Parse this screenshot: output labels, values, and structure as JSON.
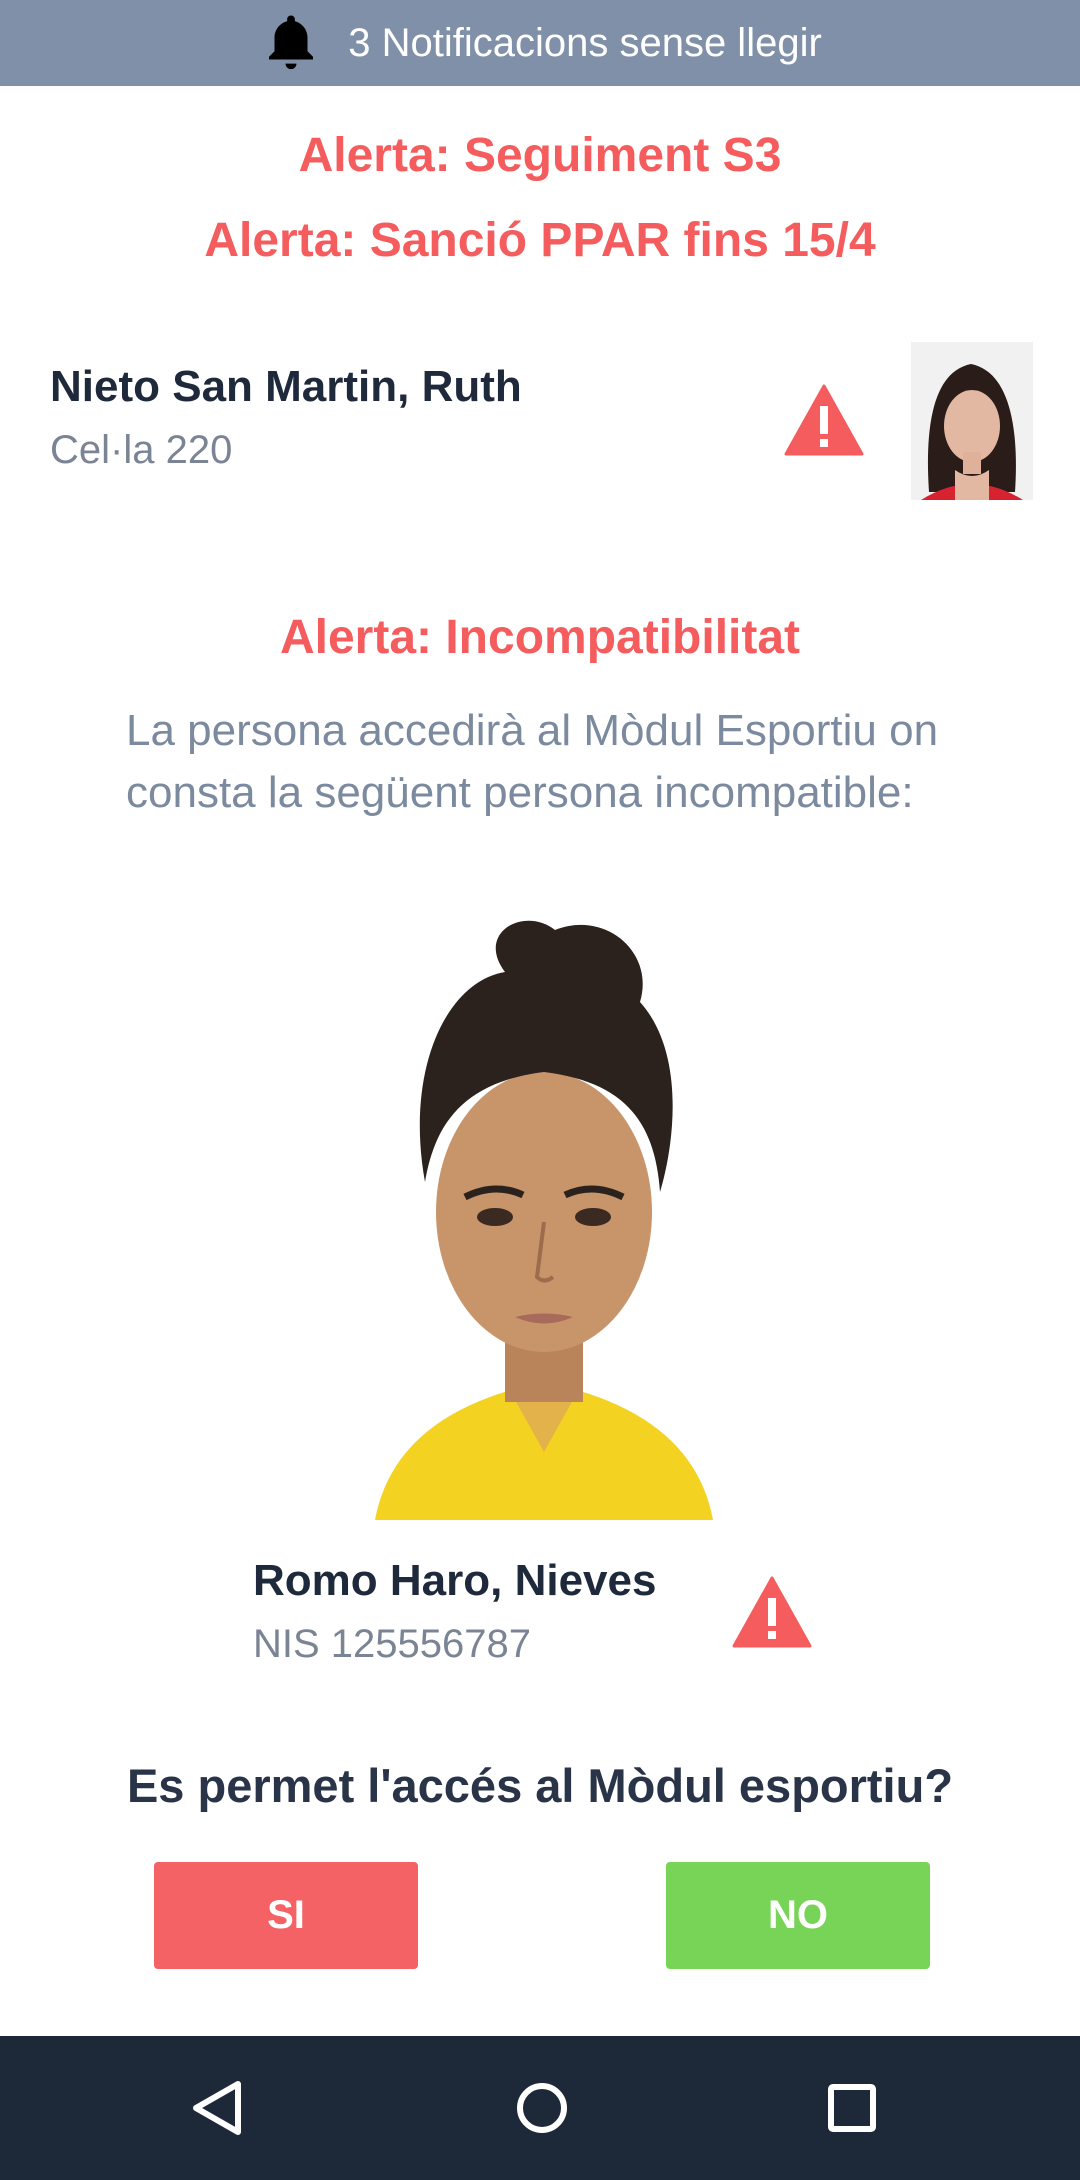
{
  "notification": {
    "icon": "bell-icon",
    "text": "3 Notificacions sense llegir"
  },
  "alerts": {
    "alert_1": "Alerta: Seguiment S3",
    "alert_2": "Alerta: Sanció PPAR fins 15/4",
    "alert_3": "Alerta: Incompatibilitat"
  },
  "person": {
    "name": "Nieto San Martin, Ruth",
    "cell": "Cel·la 220"
  },
  "incompatibility": {
    "description": "La persona accedirà al Mòdul Esportiu on consta la següent persona incompatible:",
    "name": "Romo Haro, Nieves",
    "nis": "NIS 125556787"
  },
  "question": "Es permet l'accés al Mòdul esportiu?",
  "buttons": {
    "yes": "SI",
    "no": "NO"
  },
  "colors": {
    "alert": "#f45c5d",
    "yes_button": "#f56265",
    "no_button": "#77d456",
    "notification_bar": "#8090a8",
    "nav_bar": "#1d2838"
  },
  "navbar": {
    "icons": [
      "back-triangle-icon",
      "home-circle-icon",
      "recents-square-icon"
    ]
  }
}
